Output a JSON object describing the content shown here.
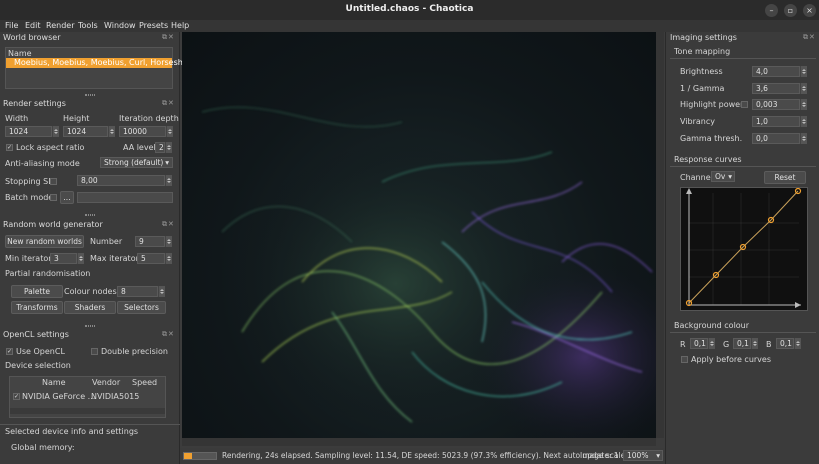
{
  "window": {
    "title": "Untitled.chaos - Chaotica"
  },
  "menu": [
    "File",
    "Edit",
    "Render",
    "Tools",
    "Window",
    "Presets",
    "Help"
  ],
  "world_browser": {
    "title": "World browser",
    "column": "Name",
    "selected_item": "Moebius, Moebius, Moebius, Curl, Horsesho..."
  },
  "render_settings": {
    "title": "Render settings",
    "width_label": "Width",
    "height_label": "Height",
    "iter_depth_label": "Iteration depth",
    "width": "1024",
    "height": "1024",
    "iter_depth": "10000",
    "lock_aspect": "Lock aspect ratio",
    "aa_level_label": "AA level",
    "aa_level": "2",
    "aa_mode_label": "Anti-aliasing mode",
    "aa_mode": "Strong (default)",
    "stopping_sl_label": "Stopping SL",
    "stopping_sl": "8,00",
    "batch_mode_label": "Batch mode",
    "batch_button": "..."
  },
  "random_world": {
    "title": "Random world generator",
    "new_button": "New random worlds",
    "number_label": "Number",
    "number": "9",
    "min_iter_label": "Min iterators",
    "min_iter": "3",
    "max_iter_label": "Max iterators",
    "max_iter": "5",
    "partial": "Partial randomisation",
    "palette": "Palette",
    "colour_nodes_label": "Colour nodes",
    "colour_nodes": "8",
    "transforms": "Transforms",
    "shaders": "Shaders",
    "selectors": "Selectors"
  },
  "opencl": {
    "title": "OpenCL settings",
    "use_opencl": "Use OpenCL",
    "double_precision": "Double precision",
    "device_selection": "Device selection",
    "columns": [
      "Name",
      "Vendor",
      "Speed"
    ],
    "device": {
      "name": "NVIDIA GeForce ...",
      "vendor": "NVIDIA",
      "speed": "5015"
    },
    "selected_info": "Selected device info and settings",
    "global_memory": "Global memory:"
  },
  "imaging": {
    "title": "Imaging settings",
    "tone_mapping": "Tone mapping",
    "brightness_label": "Brightness",
    "brightness": "4,0",
    "gamma_label": "1 / Gamma",
    "gamma": "3,6",
    "highlight_label": "Highlight power",
    "highlight": "0,003",
    "vibrancy_label": "Vibrancy",
    "vibrancy": "1,0",
    "gamma_thresh_label": "Gamma thresh.",
    "gamma_thresh": "0,0",
    "response_curves": "Response curves",
    "channel_label": "Channel:",
    "channel": "Ov",
    "reset": "Reset",
    "background_colour": "Background colour",
    "r_label": "R",
    "r": "0,1",
    "g_label": "G",
    "g": "0,1",
    "b_label": "B",
    "b": "0,1",
    "apply_before_curves": "Apply before curves"
  },
  "status": {
    "text": "Rendering, 24s elapsed. Sampling level: 11.54, DE speed: 5023.9 (97.3% efficiency). Next auto update: 1",
    "image_scale_label": "Image scale:",
    "image_scale": "100%",
    "progress": 0.25
  },
  "colors": {
    "accent": "#f0a030",
    "selection": "#f0a030"
  }
}
